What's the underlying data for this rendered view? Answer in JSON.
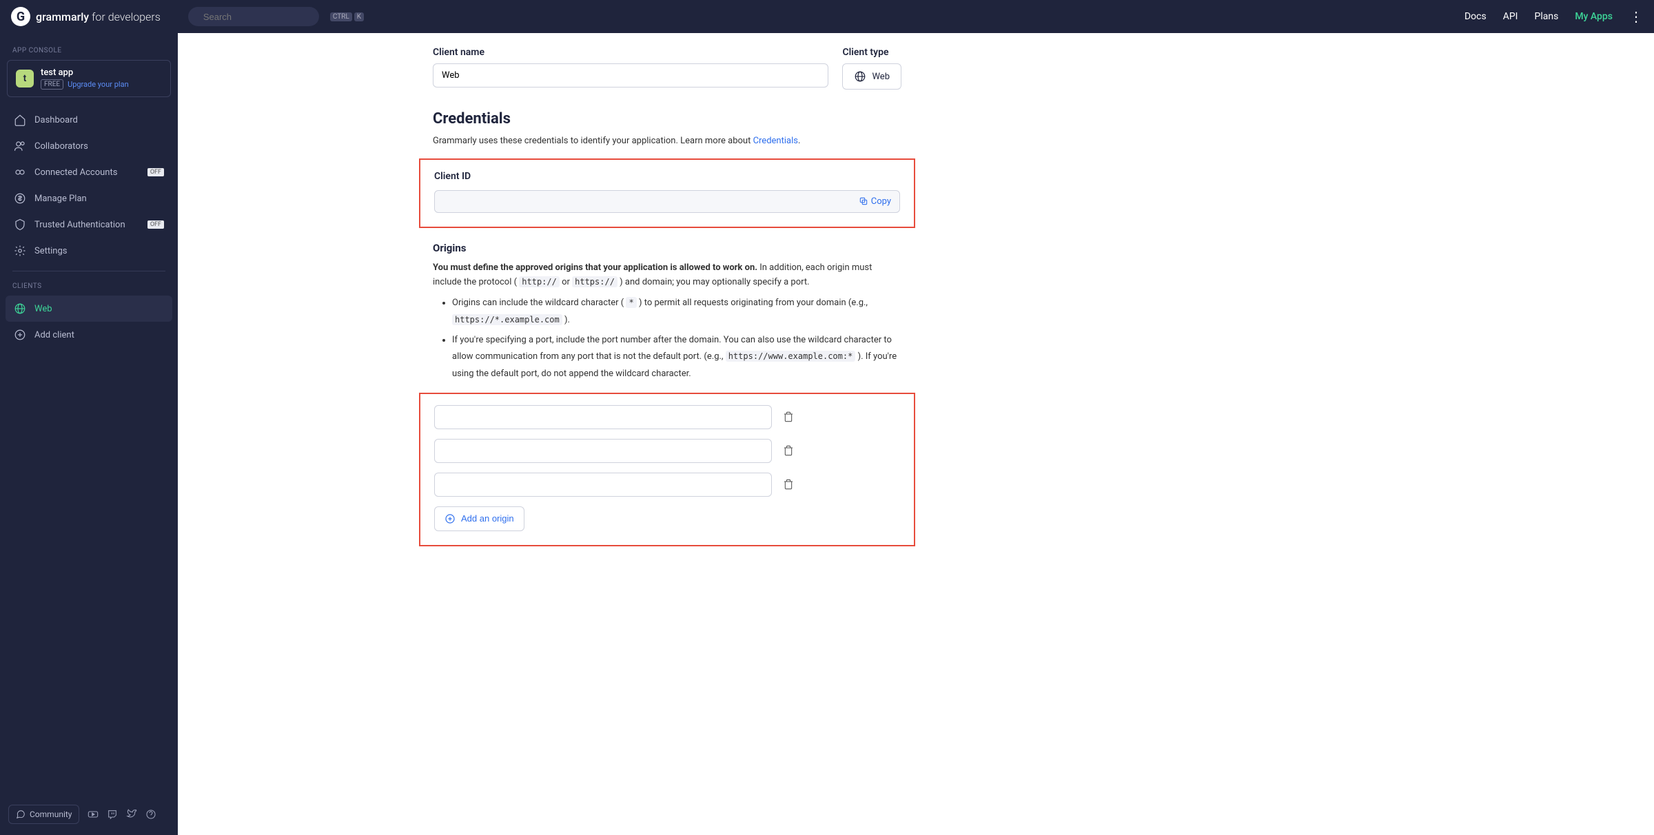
{
  "header": {
    "brand_bold": "grammarly",
    "brand_light": "for developers",
    "search_placeholder": "Search",
    "kbd1": "CTRL",
    "kbd2": "K",
    "links": {
      "docs": "Docs",
      "api": "API",
      "plans": "Plans",
      "myapps": "My Apps"
    }
  },
  "sidebar": {
    "section_console": "APP CONSOLE",
    "app": {
      "letter": "t",
      "name": "test app",
      "plan_badge": "FREE",
      "upgrade": "Upgrade your plan"
    },
    "nav": {
      "dashboard": "Dashboard",
      "collaborators": "Collaborators",
      "connected": "Connected Accounts",
      "connected_badge": "OFF",
      "manageplan": "Manage Plan",
      "trusted": "Trusted Authentication",
      "trusted_badge": "OFF",
      "settings": "Settings"
    },
    "section_clients": "CLIENTS",
    "clients": {
      "web": "Web",
      "add": "Add client"
    },
    "footer": {
      "community": "Community"
    }
  },
  "main": {
    "client_name_label": "Client name",
    "client_name_value": "Web",
    "client_type_label": "Client type",
    "client_type_value": "Web",
    "credentials_heading": "Credentials",
    "credentials_desc_pre": "Grammarly uses these credentials to identify your application. Learn more about ",
    "credentials_link": "Credentials",
    "credentials_desc_post": ".",
    "client_id_label": "Client ID",
    "copy_label": "Copy",
    "origins_heading": "Origins",
    "origins_bold": "You must define the approved origins that your application is allowed to work on.",
    "origins_rest_pre": " In addition, each origin must include the protocol ( ",
    "code_http": "http://",
    "origins_or": " or ",
    "code_https": "https://",
    "origins_rest_post": " ) and domain; you may optionally specify a port.",
    "bullet1_pre": "Origins can include the wildcard character ( ",
    "code_star": "*",
    "bullet1_mid": " ) to permit all requests originating from your domain (e.g., ",
    "code_wild": "https://*.example.com",
    "bullet1_post": " ).",
    "bullet2_pre": "If you're specifying a port, include the port number after the domain. You can also use the wildcard character to allow communication from any port that is not the default port. (e.g., ",
    "code_port": "https://www.example.com:*",
    "bullet2_post": " ). If you're using the default port, do not append the wildcard character.",
    "add_origin": "Add an origin",
    "origins": [
      "",
      "",
      ""
    ]
  }
}
